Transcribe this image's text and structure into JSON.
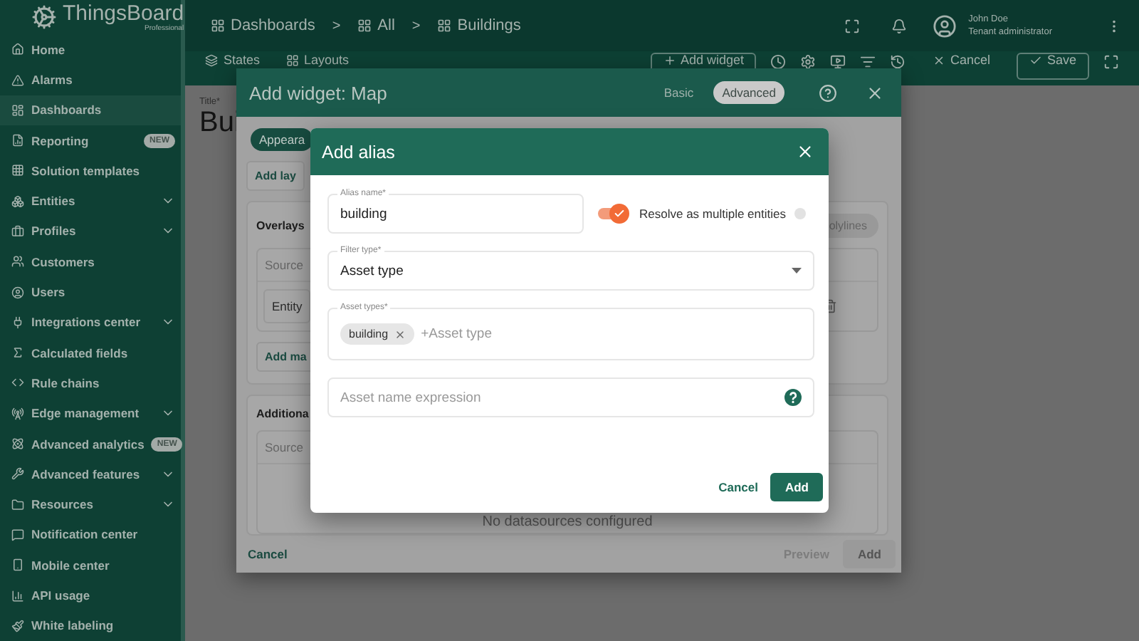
{
  "app": {
    "name": "ThingsBoard",
    "edition": "Professional"
  },
  "breadcrumbs": [
    {
      "label": "Dashboards",
      "separator": ">"
    },
    {
      "label": "All",
      "separator": ">"
    },
    {
      "label": "Buildings"
    }
  ],
  "user": {
    "name": "John Doe",
    "role": "Tenant administrator"
  },
  "sidebar": {
    "items": [
      {
        "label": "Home",
        "selected": false,
        "expandable": false
      },
      {
        "label": "Alarms",
        "selected": false,
        "expandable": false
      },
      {
        "label": "Dashboards",
        "selected": true,
        "expandable": false
      },
      {
        "label": "Reporting",
        "selected": false,
        "expandable": false,
        "badge": "NEW"
      },
      {
        "label": "Solution templates",
        "selected": false,
        "expandable": false
      },
      {
        "label": "Entities",
        "selected": false,
        "expandable": true
      },
      {
        "label": "Profiles",
        "selected": false,
        "expandable": true
      },
      {
        "label": "Customers",
        "selected": false,
        "expandable": false
      },
      {
        "label": "Users",
        "selected": false,
        "expandable": false
      },
      {
        "label": "Integrations center",
        "selected": false,
        "expandable": true
      },
      {
        "label": "Calculated fields",
        "selected": false,
        "expandable": false
      },
      {
        "label": "Rule chains",
        "selected": false,
        "expandable": false
      },
      {
        "label": "Edge management",
        "selected": false,
        "expandable": true
      },
      {
        "label": "Advanced analytics",
        "selected": false,
        "expandable": false,
        "badge": "NEW"
      },
      {
        "label": "Advanced features",
        "selected": false,
        "expandable": true
      },
      {
        "label": "Resources",
        "selected": false,
        "expandable": true
      },
      {
        "label": "Notification center",
        "selected": false,
        "expandable": false
      },
      {
        "label": "Mobile center",
        "selected": false,
        "expandable": false
      },
      {
        "label": "API usage",
        "selected": false,
        "expandable": false
      },
      {
        "label": "White labeling",
        "selected": false,
        "expandable": false
      }
    ]
  },
  "toolbar": {
    "tabs": [
      {
        "label": "States"
      },
      {
        "label": "Layouts"
      }
    ],
    "add_widget": "Add widget",
    "cancel": "Cancel",
    "save": "Save"
  },
  "dashboard": {
    "title_label": "Title*",
    "title": "Bui"
  },
  "widget_dialog": {
    "title": "Add widget: Map",
    "modes": [
      {
        "label": "Basic",
        "selected": false
      },
      {
        "label": "Advanced",
        "selected": true
      }
    ],
    "tab": "Appeara",
    "add_layer": "Add lay",
    "overlays": {
      "title": "Overlays",
      "pill": "olylines",
      "source_header": "Source",
      "entity": "Entity",
      "add": "Add ma"
    },
    "additional": {
      "title": "Additiona",
      "source_header": "Source",
      "empty": "No datasources configured"
    },
    "cancel": "Cancel",
    "preview": {
      "label": "Preview",
      "disabled": true
    },
    "add": {
      "label": "Add",
      "disabled": true
    }
  },
  "alias_dialog": {
    "title": "Add alias",
    "alias_name": {
      "label": "Alias name*",
      "value": "building"
    },
    "resolve_multiple": {
      "label": "Resolve as multiple entities",
      "on": true
    },
    "filter_type": {
      "label": "Filter type*",
      "value": "Asset type"
    },
    "asset_types": {
      "label": "Asset types*",
      "chips": [
        "building"
      ],
      "placeholder": "+Asset type"
    },
    "name_expression": {
      "placeholder": "Asset name expression"
    },
    "cancel": "Cancel",
    "add": "Add"
  }
}
